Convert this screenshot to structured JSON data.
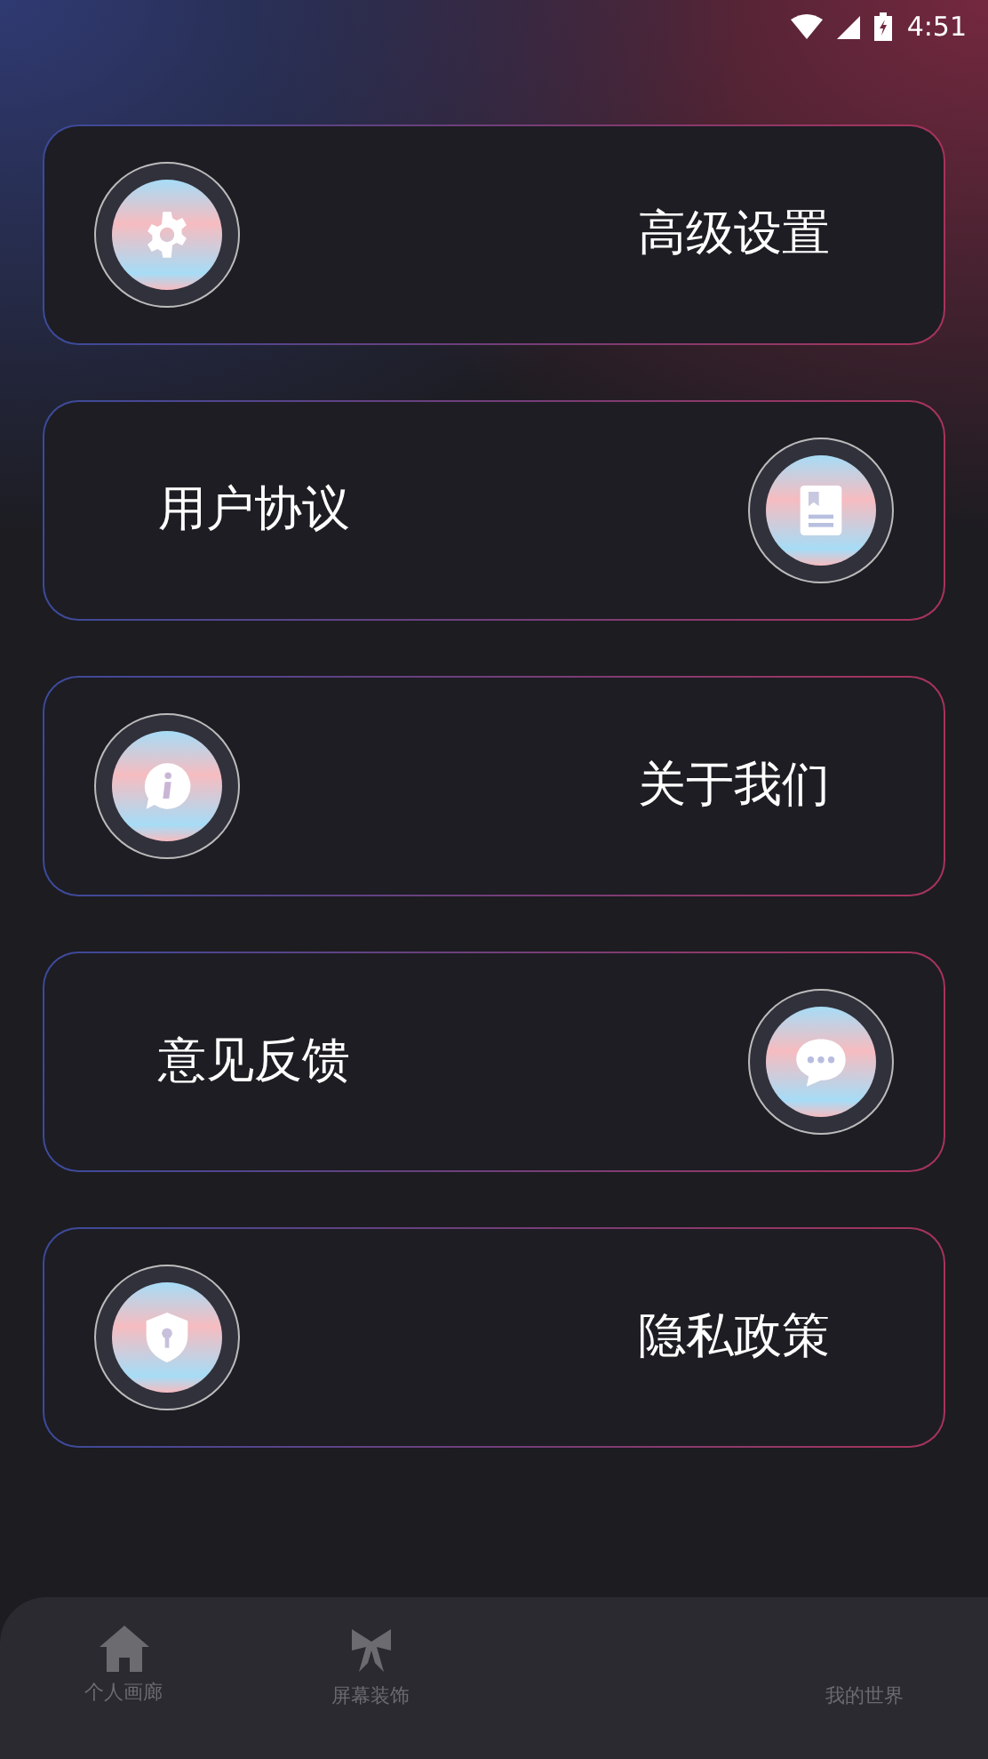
{
  "status_bar": {
    "time": "4:51"
  },
  "menu": [
    {
      "label": "高级设置",
      "kind": "iconfirst"
    },
    {
      "label": "用户协议",
      "kind": "labelfirst"
    },
    {
      "label": "关于我们",
      "kind": "iconfirst"
    },
    {
      "label": "意见反馈",
      "kind": "labelfirst"
    },
    {
      "label": "隐私政策",
      "kind": "iconfirst"
    }
  ],
  "bottom_nav": [
    {
      "label": "个人画廊"
    },
    {
      "label": "屏幕装饰"
    },
    {
      "label": "我的世界"
    }
  ]
}
